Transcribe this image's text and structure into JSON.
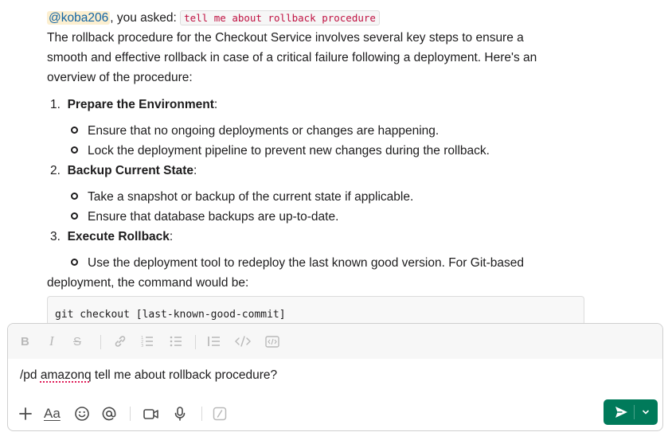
{
  "message": {
    "mention": "@koba206",
    "asked_prefix": ", you asked: ",
    "query": "tell me about rollback procedure",
    "intro_line1": "The rollback procedure for the Checkout Service involves several key steps to ensure a",
    "intro_line2": "smooth and effective rollback in case of a critical failure following a deployment. Here's an",
    "intro_line3": "overview of the procedure:",
    "steps": [
      {
        "num": "1.",
        "title": "Prepare the Environment",
        "suffix": ":",
        "bullets": [
          "Ensure that no ongoing deployments or changes are happening.",
          "Lock the deployment pipeline to prevent new changes during the rollback."
        ]
      },
      {
        "num": "2.",
        "title": "Backup Current State",
        "suffix": ":",
        "bullets": [
          "Take a snapshot or backup of the current state if applicable.",
          "Ensure that database backups are up-to-date."
        ]
      },
      {
        "num": "3.",
        "title": "Execute Rollback",
        "suffix": ":",
        "bullets": [
          "Use the deployment tool to redeploy the last known good version. For Git-based"
        ]
      }
    ],
    "continuation": "deployment, the command would be:",
    "code": "git checkout [last-known-good-commit]"
  },
  "composer": {
    "text_prefix": "/pd ",
    "text_misspelled": "amazonq",
    "text_rest": " tell me about rollback procedure?",
    "formatting": {
      "bold": "B",
      "italic": "I",
      "strike": "S"
    },
    "tools": {
      "aa": "Aa"
    }
  },
  "colors": {
    "send_button": "#007a5a",
    "mention_bg": "#fcefd0",
    "code_text": "#c01343"
  }
}
